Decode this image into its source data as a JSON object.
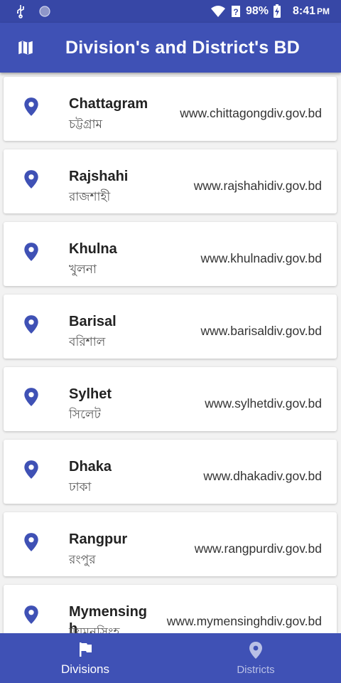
{
  "statusbar": {
    "battery": "98%",
    "time": "8:41",
    "ampm": "PM"
  },
  "appbar": {
    "title": "Division's and District's BD",
    "icon": "map-icon"
  },
  "divisions": [
    {
      "name": "Chattagram",
      "bangla": "চট্টগ্রাম",
      "url": "www.chittagongdiv.gov.bd"
    },
    {
      "name": "Rajshahi",
      "bangla": "রাজশাহী",
      "url": "www.rajshahidiv.gov.bd"
    },
    {
      "name": "Khulna",
      "bangla": "খুলনা",
      "url": "www.khulnadiv.gov.bd"
    },
    {
      "name": "Barisal",
      "bangla": "বরিশাল",
      "url": "www.barisaldiv.gov.bd"
    },
    {
      "name": "Sylhet",
      "bangla": "সিলেট",
      "url": "www.sylhetdiv.gov.bd"
    },
    {
      "name": "Dhaka",
      "bangla": "ঢাকা",
      "url": "www.dhakadiv.gov.bd"
    },
    {
      "name": "Rangpur",
      "bangla": "রংপুর",
      "url": "www.rangpurdiv.gov.bd"
    },
    {
      "name": "Mymensingh",
      "bangla": "ময়মনসিংহ",
      "url": "www.mymensinghdiv.gov.bd"
    }
  ],
  "bottomnav": [
    {
      "label": "Divisions",
      "icon": "flag-icon",
      "active": true
    },
    {
      "label": "Districts",
      "icon": "location-pin-icon",
      "active": false
    }
  ],
  "colors": {
    "primary": "#3f51b5",
    "statusbar": "#3747a6",
    "pin": "#3f51b5",
    "inactive_nav": "#b9c0e6"
  }
}
